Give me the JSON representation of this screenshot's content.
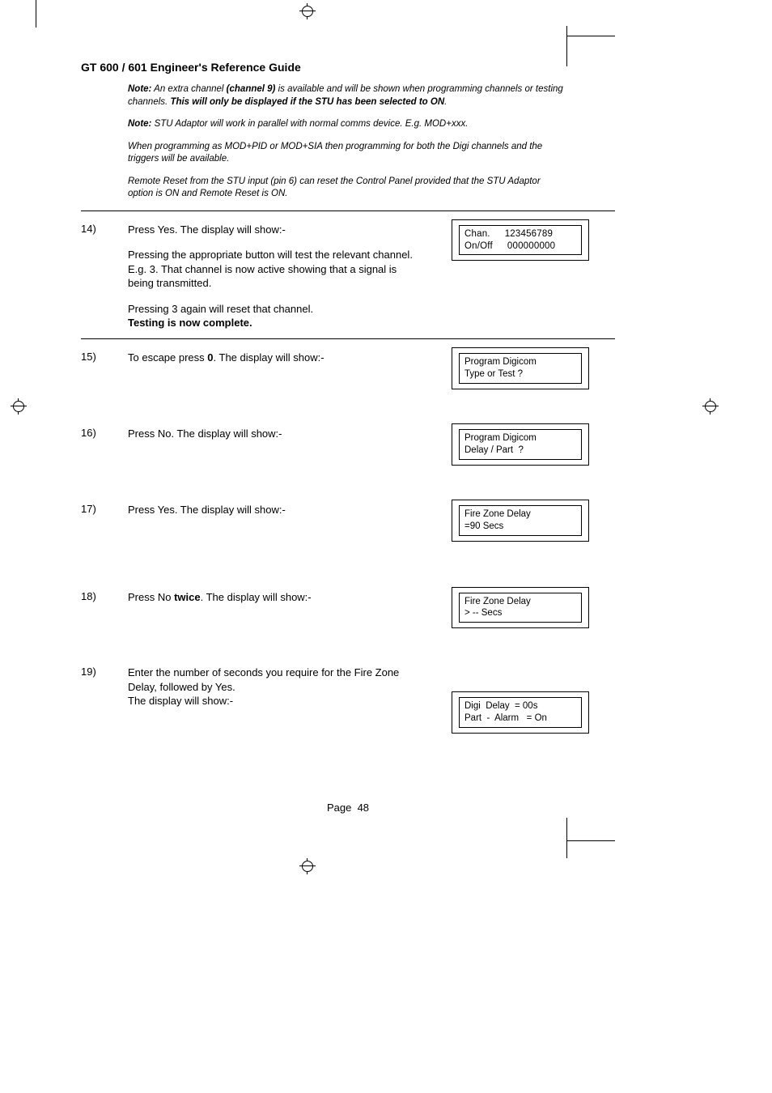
{
  "title": "GT 600 / 601 Engineer's Reference Guide",
  "notes": {
    "p1a": "Note:",
    "p1b": " An extra channel ",
    "p1c": "(channel 9)",
    "p1d": " is available and will be shown when programming channels or testing channels. ",
    "p1e": "This will only be displayed if the STU has been selected to ON",
    "p1f": ".",
    "p2a": "Note:",
    "p2b": " STU Adaptor will work in parallel with normal comms device. E.g. MOD+xxx.",
    "p3": "When programming as MOD+PID or MOD+SIA then programming for both the Digi channels and the triggers will be available.",
    "p4": "Remote Reset from the STU input (pin 6) can reset the Control Panel provided that the STU Adaptor option is ON and Remote Reset is ON."
  },
  "step14": {
    "num": "14)",
    "p1": "Press Yes. The display will show:-",
    "p2": "Pressing the appropriate button will test the relevant channel. E.g. 3. That channel is now active showing that a signal is being transmitted.",
    "p3a": "Pressing 3 again will reset that channel.",
    "p3b": "Testing is now complete.",
    "lcd_l1a": "Chan.",
    "lcd_l1b": "123456789",
    "lcd_l2a": "On/Off",
    "lcd_l2b": "000000000"
  },
  "step15": {
    "num": "15)",
    "text_a": "To escape press ",
    "text_b": "0",
    "text_c": ". The display will show:-",
    "lcd": "Program Digicom\nType or Test ?"
  },
  "step16": {
    "num": "16)",
    "text": "Press No. The display will show:-",
    "lcd": "Program Digicom\nDelay / Part  ?"
  },
  "step17": {
    "num": "17)",
    "text": "Press Yes. The display will show:-",
    "lcd": "Fire Zone Delay\n=90 Secs"
  },
  "step18": {
    "num": "18)",
    "text_a": "Press No ",
    "text_b": "twice",
    "text_c": ". The display will show:-",
    "lcd": "Fire Zone Delay\n> -- Secs"
  },
  "step19": {
    "num": "19)",
    "text": "Enter the number of seconds you require for the Fire Zone Delay, followed by Yes.\nThe display will show:-",
    "lcd": "Digi  Delay  = 00s\nPart  -  Alarm   = On"
  },
  "footer": {
    "label": "Page",
    "num": "48"
  }
}
